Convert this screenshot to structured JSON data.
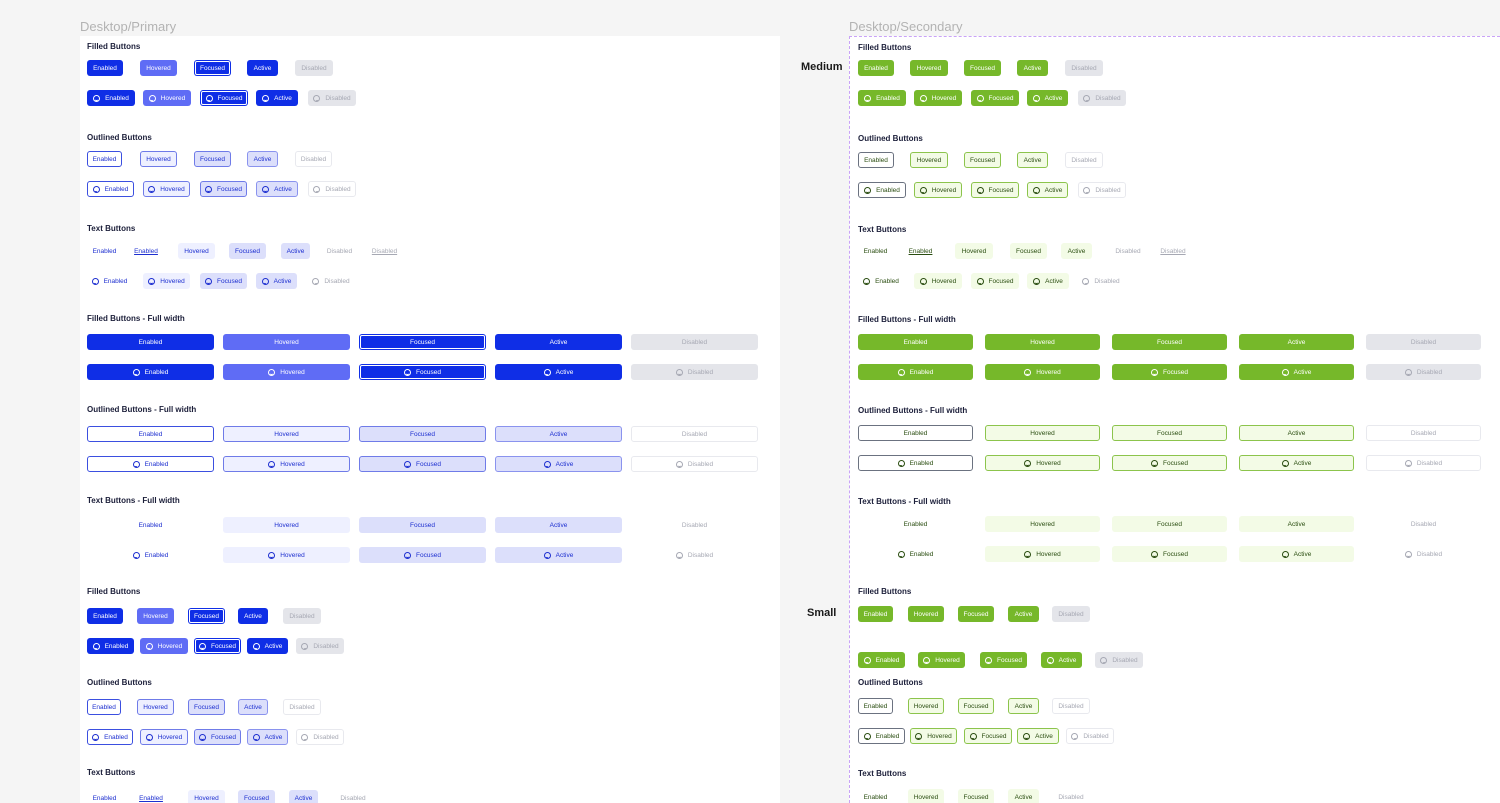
{
  "frames": {
    "primary_title": "Desktop/Primary",
    "secondary_title": "Desktop/Secondary"
  },
  "size_labels": {
    "medium": "Medium",
    "small": "Small"
  },
  "colors": {
    "primary_filled": "#0f2ee6",
    "primary_hovered": "#5f6cf5",
    "secondary_filled": "#76b82a",
    "disabled_bg": "#e4e5ea",
    "disabled_text": "#a6a8b3"
  },
  "section_titles": {
    "filled": "Filled Buttons",
    "outlined": "Outlined Buttons",
    "text": "Text Buttons",
    "filled_full": "Filled Buttons - Full width",
    "outlined_full": "Outlined Buttons - Full width",
    "text_full": "Text Buttons - Full width"
  },
  "button_labels": {
    "enabled": "Enabled",
    "hovered": "Hovered",
    "focused": "Focused",
    "active": "Active",
    "disabled": "Disabled"
  },
  "button_icon": "smiley-icon"
}
